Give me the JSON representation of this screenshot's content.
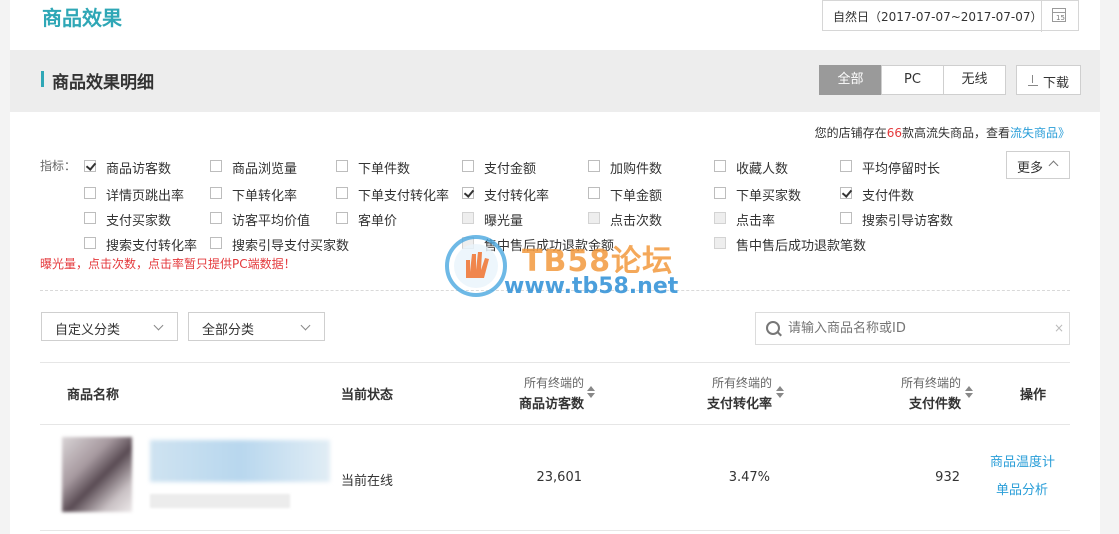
{
  "page": {
    "title": "商品效果"
  },
  "date_range": {
    "label": "自然日（2017-07-07~2017-07-07）"
  },
  "section": {
    "title": "商品效果明细"
  },
  "device_tabs": [
    {
      "label": "全部",
      "active": true
    },
    {
      "label": "PC",
      "active": false
    },
    {
      "label": "无线",
      "active": false
    }
  ],
  "download": {
    "label": "下载"
  },
  "notice": {
    "prefix": "您的店铺存在",
    "count": "66",
    "middle": "款高流失商品，查看",
    "link": "流失商品》"
  },
  "metrics": {
    "label": "指标：",
    "more_label": "更多",
    "items": [
      {
        "label": "商品访客数",
        "checked": true,
        "disabled": false
      },
      {
        "label": "商品浏览量",
        "checked": false,
        "disabled": false
      },
      {
        "label": "下单件数",
        "checked": false,
        "disabled": false
      },
      {
        "label": "支付金额",
        "checked": false,
        "disabled": false
      },
      {
        "label": "加购件数",
        "checked": false,
        "disabled": false
      },
      {
        "label": "收藏人数",
        "checked": false,
        "disabled": false
      },
      {
        "label": "平均停留时长",
        "checked": false,
        "disabled": false
      },
      {
        "label": "详情页跳出率",
        "checked": false,
        "disabled": false
      },
      {
        "label": "下单转化率",
        "checked": false,
        "disabled": false
      },
      {
        "label": "下单支付转化率",
        "checked": false,
        "disabled": false
      },
      {
        "label": "支付转化率",
        "checked": true,
        "disabled": false
      },
      {
        "label": "下单金额",
        "checked": false,
        "disabled": false
      },
      {
        "label": "下单买家数",
        "checked": false,
        "disabled": false
      },
      {
        "label": "支付件数",
        "checked": true,
        "disabled": false
      },
      {
        "label": "支付买家数",
        "checked": false,
        "disabled": false
      },
      {
        "label": "访客平均价值",
        "checked": false,
        "disabled": false
      },
      {
        "label": "客单价",
        "checked": false,
        "disabled": false
      },
      {
        "label": "曝光量",
        "checked": false,
        "disabled": true
      },
      {
        "label": "点击次数",
        "checked": false,
        "disabled": true
      },
      {
        "label": "点击率",
        "checked": false,
        "disabled": true
      },
      {
        "label": "搜索引导访客数",
        "checked": false,
        "disabled": false
      },
      {
        "label": "搜索支付转化率",
        "checked": false,
        "disabled": false
      },
      {
        "label": "搜索引导支付买家数",
        "checked": false,
        "disabled": false
      },
      {
        "label": "售中售后成功退款金额",
        "checked": false,
        "disabled": true
      },
      {
        "label": "售中售后成功退款笔数",
        "checked": false,
        "disabled": true
      }
    ]
  },
  "warning": "曝光量，点击次数，点击率暂只提供PC端数据！",
  "filters": {
    "category1": "自定义分类",
    "category2": "全部分类"
  },
  "search": {
    "placeholder": "请输入商品名称或ID",
    "clear": "×"
  },
  "table": {
    "col_name": "商品名称",
    "col_status": "当前状态",
    "col_prefix": "所有终端的",
    "col_visitors": "商品访客数",
    "col_conversion": "支付转化率",
    "col_items": "支付件数",
    "col_ops": "操作",
    "rows": [
      {
        "status": "当前在线",
        "visitors": "23,601",
        "conversion": "3.47%",
        "items": "932",
        "op1": "商品温度计",
        "op2": "单品分析"
      }
    ]
  },
  "watermark": {
    "line1": "TB58论坛",
    "line2": "www.tb58.net"
  },
  "colors": {
    "accent": "#2fa7b6",
    "link": "#2a9ed8",
    "warning": "#e4393c"
  }
}
